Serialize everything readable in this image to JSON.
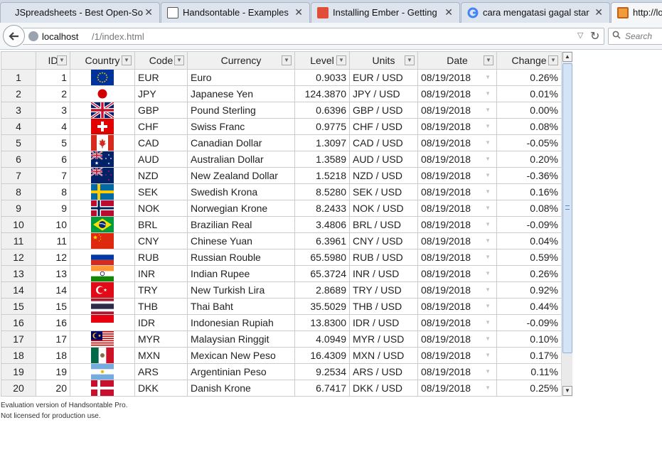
{
  "browser": {
    "tabs": [
      {
        "title": "JSpreadsheets - Best Open-Sou...",
        "close": "✕"
      },
      {
        "title": "Handsontable - Examples",
        "close": "✕"
      },
      {
        "title": "Installing Ember - Getting ...",
        "close": "✕"
      },
      {
        "title": "cara mengatasi gagal start ...",
        "close": "✕"
      },
      {
        "title": "http://lo"
      }
    ],
    "url_host": "localhost",
    "url_path": "/1/index.html",
    "search_placeholder": "Search"
  },
  "grid": {
    "columns": [
      "ID",
      "Country",
      "Code",
      "Currency",
      "Level",
      "Units",
      "Date",
      "Change"
    ],
    "rows": [
      {
        "n": "1",
        "id": "1",
        "flag": "eu-flag-icon",
        "code": "EUR",
        "currency": "Euro",
        "level": "0.9033",
        "units": "EUR / USD",
        "date": "08/19/2018",
        "change": "0.26%"
      },
      {
        "n": "2",
        "id": "2",
        "flag": "japan-flag-icon",
        "code": "JPY",
        "currency": "Japanese Yen",
        "level": "124.3870",
        "units": "JPY / USD",
        "date": "08/19/2018",
        "change": "0.01%"
      },
      {
        "n": "3",
        "id": "3",
        "flag": "uk-flag-icon",
        "code": "GBP",
        "currency": "Pound Sterling",
        "level": "0.6396",
        "units": "GBP / USD",
        "date": "08/19/2018",
        "change": "0.00%"
      },
      {
        "n": "4",
        "id": "4",
        "flag": "switzerland-flag-icon",
        "code": "CHF",
        "currency": "Swiss Franc",
        "level": "0.9775",
        "units": "CHF / USD",
        "date": "08/19/2018",
        "change": "0.08%"
      },
      {
        "n": "5",
        "id": "5",
        "flag": "canada-flag-icon",
        "code": "CAD",
        "currency": "Canadian Dollar",
        "level": "1.3097",
        "units": "CAD / USD",
        "date": "08/19/2018",
        "change": "-0.05%"
      },
      {
        "n": "6",
        "id": "6",
        "flag": "australia-flag-icon",
        "code": "AUD",
        "currency": "Australian Dollar",
        "level": "1.3589",
        "units": "AUD / USD",
        "date": "08/19/2018",
        "change": "0.20%"
      },
      {
        "n": "7",
        "id": "7",
        "flag": "new-zealand-flag-icon",
        "code": "NZD",
        "currency": "New Zealand Dollar",
        "level": "1.5218",
        "units": "NZD / USD",
        "date": "08/19/2018",
        "change": "-0.36%"
      },
      {
        "n": "8",
        "id": "8",
        "flag": "sweden-flag-icon",
        "code": "SEK",
        "currency": "Swedish Krona",
        "level": "8.5280",
        "units": "SEK / USD",
        "date": "08/19/2018",
        "change": "0.16%"
      },
      {
        "n": "9",
        "id": "9",
        "flag": "norway-flag-icon",
        "code": "NOK",
        "currency": "Norwegian Krone",
        "level": "8.2433",
        "units": "NOK / USD",
        "date": "08/19/2018",
        "change": "0.08%"
      },
      {
        "n": "10",
        "id": "10",
        "flag": "brazil-flag-icon",
        "code": "BRL",
        "currency": "Brazilian Real",
        "level": "3.4806",
        "units": "BRL / USD",
        "date": "08/19/2018",
        "change": "-0.09%"
      },
      {
        "n": "11",
        "id": "11",
        "flag": "china-flag-icon",
        "code": "CNY",
        "currency": "Chinese Yuan",
        "level": "6.3961",
        "units": "CNY / USD",
        "date": "08/19/2018",
        "change": "0.04%"
      },
      {
        "n": "12",
        "id": "12",
        "flag": "russia-flag-icon",
        "code": "RUB",
        "currency": "Russian Rouble",
        "level": "65.5980",
        "units": "RUB / USD",
        "date": "08/19/2018",
        "change": "0.59%"
      },
      {
        "n": "13",
        "id": "13",
        "flag": "india-flag-icon",
        "code": "INR",
        "currency": "Indian Rupee",
        "level": "65.3724",
        "units": "INR / USD",
        "date": "08/19/2018",
        "change": "0.26%"
      },
      {
        "n": "14",
        "id": "14",
        "flag": "turkey-flag-icon",
        "code": "TRY",
        "currency": "New Turkish Lira",
        "level": "2.8689",
        "units": "TRY / USD",
        "date": "08/19/2018",
        "change": "0.92%"
      },
      {
        "n": "15",
        "id": "15",
        "flag": "thailand-flag-icon",
        "code": "THB",
        "currency": "Thai Baht",
        "level": "35.5029",
        "units": "THB / USD",
        "date": "08/19/2018",
        "change": "0.44%"
      },
      {
        "n": "16",
        "id": "16",
        "flag": "indonesia-flag-icon",
        "code": "IDR",
        "currency": "Indonesian Rupiah",
        "level": "13.8300",
        "units": "IDR / USD",
        "date": "08/19/2018",
        "change": "-0.09%"
      },
      {
        "n": "17",
        "id": "17",
        "flag": "malaysia-flag-icon",
        "code": "MYR",
        "currency": "Malaysian Ringgit",
        "level": "4.0949",
        "units": "MYR / USD",
        "date": "08/19/2018",
        "change": "0.10%"
      },
      {
        "n": "18",
        "id": "18",
        "flag": "mexico-flag-icon",
        "code": "MXN",
        "currency": "Mexican New Peso",
        "level": "16.4309",
        "units": "MXN / USD",
        "date": "08/19/2018",
        "change": "0.17%"
      },
      {
        "n": "19",
        "id": "19",
        "flag": "argentina-flag-icon",
        "code": "ARS",
        "currency": "Argentinian Peso",
        "level": "9.2534",
        "units": "ARS / USD",
        "date": "08/19/2018",
        "change": "0.11%"
      },
      {
        "n": "20",
        "id": "20",
        "flag": "denmark-flag-icon",
        "code": "DKK",
        "currency": "Danish Krone",
        "level": "6.7417",
        "units": "DKK / USD",
        "date": "08/19/2018",
        "change": "0.25%"
      }
    ]
  },
  "footer": {
    "line1": "Evaluation version of Handsontable Pro.",
    "line2": "Not licensed for production use."
  }
}
